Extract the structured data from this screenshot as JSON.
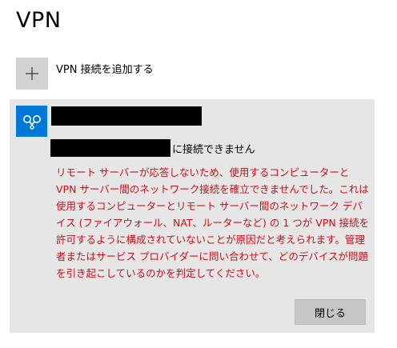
{
  "page": {
    "title": "VPN"
  },
  "add_connection": {
    "label": "VPN 接続を追加する",
    "icon": "plus-icon"
  },
  "connection": {
    "icon": "vpn-link-icon",
    "status": "に接続できません",
    "error_message": "リモート サーバーが応答しないため、使用するコンピューターと VPN サーバー間のネットワーク接続を確立できませんでした。これは使用するコンピューターとリモート サーバー間のネットワーク デバイス (ファイアウォール、NAT、ルーターなど) の 1 つが VPN 接続を許可するように構成されていないことが原因だと考えられます。管理者またはサービス プロバイダーに問い合わせて、どのデバイスが問題を引き起こしているのかを判定してください。",
    "close_label": "閉じる"
  },
  "colors": {
    "accent": "#0078d7",
    "error": "#c8101a",
    "panel": "#e6e6e6"
  }
}
